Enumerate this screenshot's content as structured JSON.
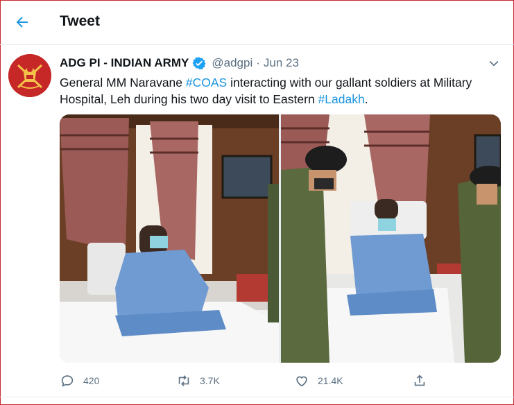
{
  "header": {
    "title": "Tweet",
    "back_icon": "arrow-left-icon"
  },
  "tweet": {
    "author_name": "ADG PI - INDIAN ARMY",
    "handle": "@adgpi",
    "separator": "·",
    "date": "Jun 23",
    "text": {
      "part1": "General MM Naravane ",
      "hashtag1": "#COAS",
      "part2": " interacting with our gallant soldiers at Military Hospital, Leh during his two day visit to Eastern ",
      "hashtag2": "#Ladakh",
      "part3": "."
    },
    "media": [
      {
        "icon": "photo-soldier-on-hospital-bed"
      },
      {
        "icon": "photo-general-visiting-soldier"
      }
    ]
  },
  "actions": {
    "reply_count": "420",
    "retweet_count": "3.7K",
    "like_count": "21.4K"
  },
  "colors": {
    "accent": "#1b95e0",
    "verified": "#1da1f2",
    "secondary_text": "#5b7083",
    "avatar_bg": "#c62828",
    "frame_border": "#c8252b"
  }
}
